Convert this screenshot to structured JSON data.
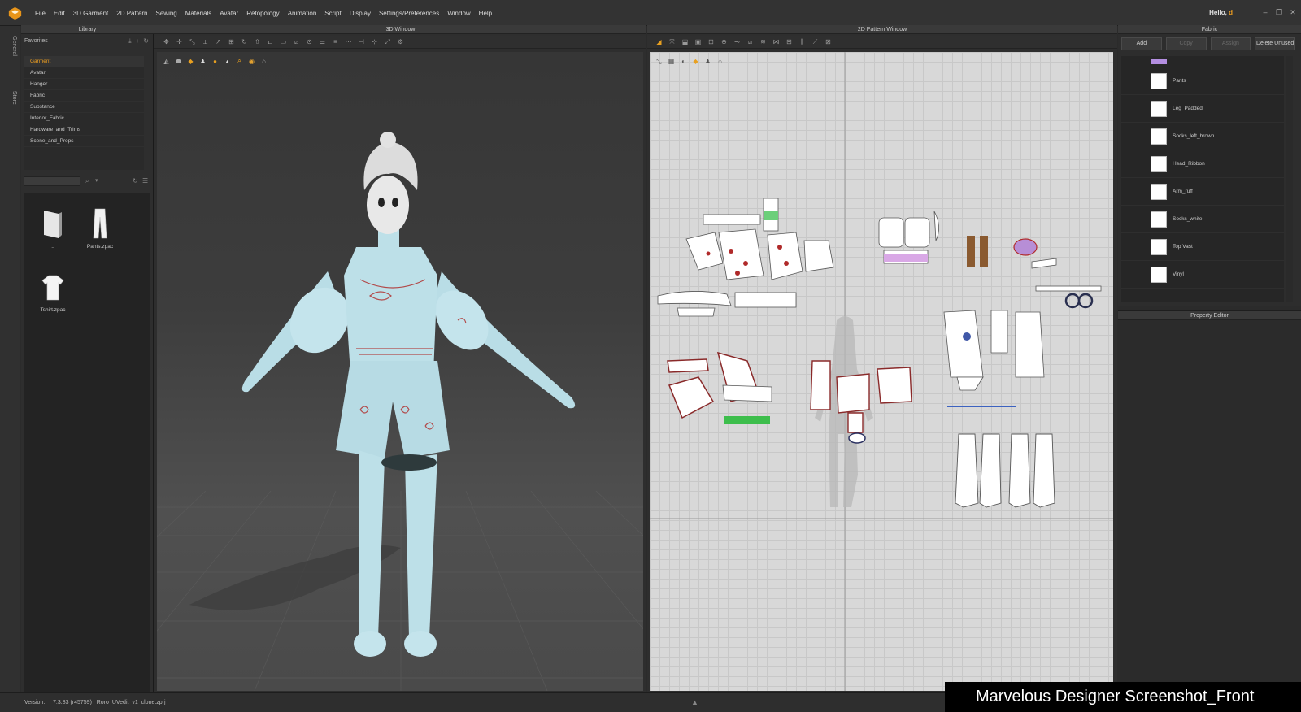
{
  "app": {
    "brand_color": "#f0a020",
    "menu": [
      "File",
      "Edit",
      "3D Garment",
      "2D Pattern",
      "Sewing",
      "Materials",
      "Avatar",
      "Retopology",
      "Animation",
      "Script",
      "Display",
      "Settings/Preferences",
      "Window",
      "Help"
    ],
    "user_greeting": "Hello,",
    "user_name": "d"
  },
  "left_strip": {
    "tabs": [
      "General",
      "Store"
    ]
  },
  "library": {
    "title": "Library",
    "favorites_label": "Favorites",
    "tree": [
      "Garment",
      "Avatar",
      "Hanger",
      "Fabric",
      "Substance",
      "Interior_Fabric",
      "Hardware_and_Trims",
      "Scene_and_Props"
    ],
    "selected": "Garment",
    "files": [
      {
        "name": "..",
        "icon": "folder-up-icon"
      },
      {
        "name": "Pants.zpac",
        "icon": "pants-icon"
      },
      {
        "name": "Tshirt.zpac",
        "icon": "tshirt-icon"
      }
    ]
  },
  "window3d": {
    "title": "3D Window"
  },
  "window2d": {
    "title": "2D Pattern Window"
  },
  "fabric": {
    "title": "Fabric",
    "buttons": {
      "add": "Add",
      "copy": "Copy",
      "assign": "Assign",
      "delete_unused": "Delete Unused"
    },
    "top_swatch_color": "#b38ee0",
    "items": [
      "Pants",
      "Leg_Padded",
      "Socks_left_brown",
      "Head_Ribbon",
      "Arm_ruff",
      "Socks_white",
      "Top Vast",
      "Vinyl"
    ]
  },
  "property_editor": {
    "title": "Property Editor"
  },
  "status": {
    "version_label": "Version:",
    "version": "7.3.83 (r45759)",
    "file": "Roro_UVedit_v1_clone.zprj"
  },
  "caption": "Marvelous Designer Screenshot_Front"
}
